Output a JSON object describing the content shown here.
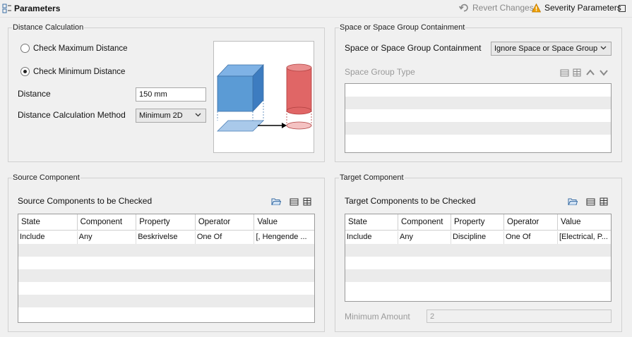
{
  "header": {
    "title": "Parameters",
    "revert_label": "Revert Changes",
    "severity_label": "Severity Parameters"
  },
  "distance_calc": {
    "group_title": "Distance Calculation",
    "radio_max": "Check Maximum Distance",
    "radio_min": "Check Minimum Distance",
    "selected": "min",
    "distance_label": "Distance",
    "distance_value": "150 mm",
    "method_label": "Distance Calculation Method",
    "method_value": "Minimum 2D"
  },
  "space": {
    "group_title": "Space or Space Group Containment",
    "containment_label": "Space or Space Group Containment",
    "containment_value": "Ignore Space or Space Group",
    "group_type_label": "Space Group Type"
  },
  "source": {
    "group_title": "Source Component",
    "list_title": "Source Components to be Checked",
    "columns": [
      "State",
      "Component",
      "Property",
      "Operator",
      "Value"
    ],
    "rows": [
      [
        "Include",
        "Any",
        "Beskrivelse",
        "One Of",
        "[, Hengende ..."
      ]
    ]
  },
  "target": {
    "group_title": "Target Component",
    "list_title": "Target Components to be Checked",
    "columns": [
      "State",
      "Component",
      "Property",
      "Operator",
      "Value"
    ],
    "rows": [
      [
        "Include",
        "Any",
        "Discipline",
        "One Of",
        "[Electrical, P..."
      ]
    ],
    "min_amount_label": "Minimum Amount",
    "min_amount_value": "2"
  },
  "icons": {
    "panel": "parameters-panel-icon",
    "revert": "revert-icon",
    "severity": "warning-icon",
    "maximize": "maximize-icon",
    "open_folder": "open-folder-icon",
    "add_row": "add-row-icon",
    "edit_table": "edit-table-icon",
    "move_up": "arrow-up-icon",
    "move_down": "arrow-down-icon"
  },
  "colors": {
    "cube_blue": "#5b9bd5",
    "cylinder_red": "#e06666",
    "warning_orange": "#f0a000"
  }
}
